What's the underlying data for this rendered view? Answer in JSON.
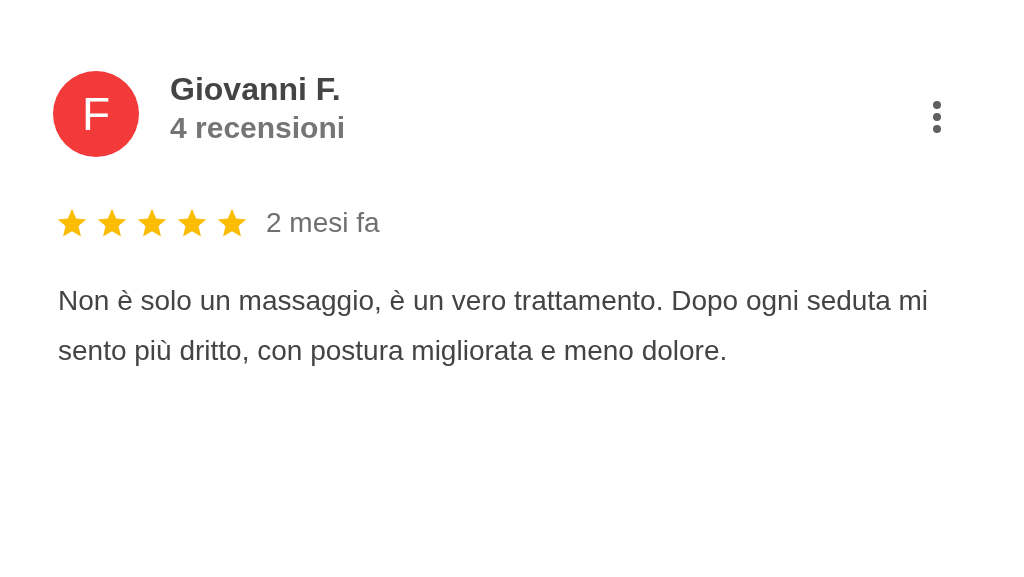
{
  "review": {
    "avatar_letter": "F",
    "author": "Giovanni F.",
    "review_count": "4 recensioni",
    "stars": 5,
    "time": "2 mesi fa",
    "text": "Non è solo un massaggio, è un vero trattamento. Dopo ogni seduta mi sento più dritto, con postura migliorata e meno dolore."
  }
}
